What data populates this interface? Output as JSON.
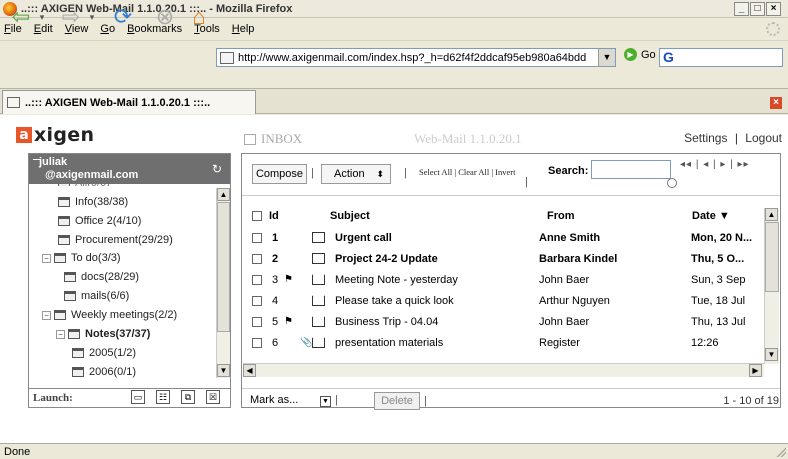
{
  "window": {
    "title": "..::: AXIGEN Web-Mail 1.1.0.20.1 :::.. - Mozilla Firefox"
  },
  "menu": [
    {
      "pre": "",
      "u": "F",
      "post": "ile"
    },
    {
      "pre": "",
      "u": "E",
      "post": "dit"
    },
    {
      "pre": "",
      "u": "V",
      "post": "iew"
    },
    {
      "pre": "",
      "u": "G",
      "post": "o"
    },
    {
      "pre": "",
      "u": "B",
      "post": "ookmarks"
    },
    {
      "pre": "",
      "u": "T",
      "post": "ools"
    },
    {
      "pre": "",
      "u": "H",
      "post": "elp"
    }
  ],
  "address": {
    "url": "http://www.axigenmail.com/index.hsp?_h=d62f4f2ddcaf95eb980a64bdd ",
    "go_label": "Go",
    "search_letter": "G"
  },
  "tab": {
    "title": "..::: AXIGEN Web-Mail 1.1.0.20.1 :::.."
  },
  "app": {
    "logo_text": "xigen",
    "logo_x": "a",
    "folder_label": "INBOX",
    "version_label": "Web-Mail 1.1.0.20.1",
    "settings_label": "Settings",
    "logout_label": "Logout",
    "link_separator": "|"
  },
  "account": {
    "name": "juliak",
    "email": "@axigenmail.com"
  },
  "folders": [
    {
      "label": "Info(38/38)",
      "toggle": ""
    },
    {
      "label": "Office 2(4/10)",
      "toggle": ""
    },
    {
      "label": "Procurement(29/29)",
      "toggle": ""
    },
    {
      "label": "To do(3/3)",
      "toggle": "−"
    },
    {
      "label": "docs(28/29)",
      "toggle": ""
    },
    {
      "label": "mails(6/6)",
      "toggle": ""
    },
    {
      "label": "Weekly meetings(2/2)",
      "toggle": "−"
    },
    {
      "label": "Notes(37/37)",
      "toggle": "−"
    },
    {
      "label": "2005(1/2)",
      "toggle": ""
    },
    {
      "label": "2006(0/1)",
      "toggle": ""
    }
  ],
  "launch_label": "Launch:",
  "toolbar": {
    "compose": "Compose",
    "action": "Action",
    "select_all": "Select All",
    "clear_all": "Clear All",
    "invert": "Invert",
    "search_label": "Search:",
    "pager": "◂◂ | ◂ | ▸ | ▸▸"
  },
  "columns": {
    "id": "Id",
    "subject": "Subject",
    "from": "From",
    "date": "Date ▼"
  },
  "messages": [
    {
      "id": "1",
      "subject": "Urgent call",
      "from": "Anne Smith",
      "date": "Mon, 20 N...",
      "unread": true,
      "flag": "",
      "attach": ""
    },
    {
      "id": "2",
      "subject": "Project 24-2 Update",
      "from": "Barbara Kindel",
      "date": "Thu, 5 O...",
      "unread": true,
      "flag": "",
      "attach": ""
    },
    {
      "id": "3",
      "subject": "Meeting Note - yesterday",
      "from": "John Baer",
      "date": "Sun, 3 Sep",
      "unread": false,
      "flag": "⚑",
      "attach": ""
    },
    {
      "id": "4",
      "subject": "Please take a quick look",
      "from": "Arthur Nguyen",
      "date": "Tue, 18 Jul",
      "unread": false,
      "flag": "",
      "attach": ""
    },
    {
      "id": "5",
      "subject": "Business Trip - 04.04",
      "from": "John Baer",
      "date": "Thu, 13 Jul",
      "unread": false,
      "flag": "⚑",
      "attach": ""
    },
    {
      "id": "6",
      "subject": "presentation materials",
      "from": "Register",
      "date": "12:26",
      "unread": false,
      "flag": "",
      "attach": "📎"
    }
  ],
  "footer": {
    "mark_as": "Mark as...",
    "delete": "Delete",
    "count": "1 - 10 of 19"
  },
  "status": "Done"
}
